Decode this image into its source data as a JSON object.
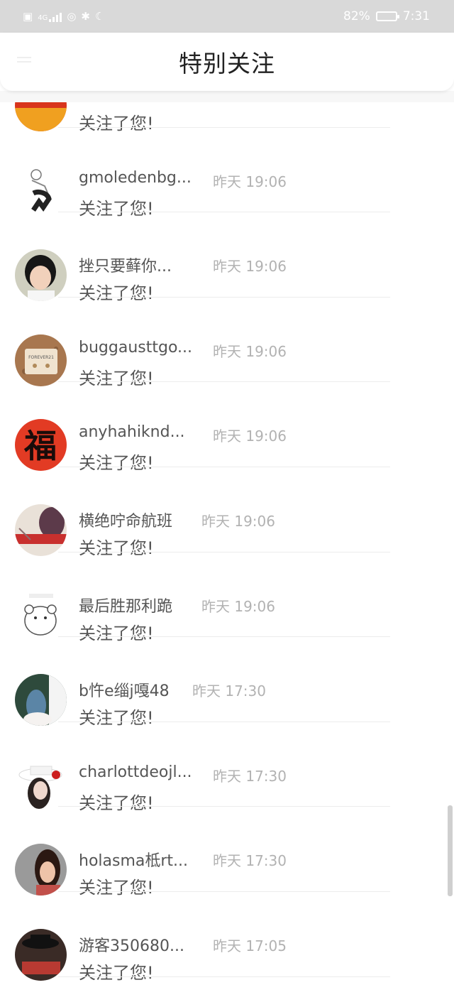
{
  "status_bar": {
    "left_icons": [
      "hd-icon",
      "4g-signal-icon",
      "wifi-hotspot-icon",
      "bluetooth-icon",
      "moon-icon"
    ],
    "network_label": "4G",
    "battery_percent": "82%",
    "battery_level": 0.82,
    "time": "7:31"
  },
  "header": {
    "title": "特别关注"
  },
  "list": [
    {
      "name": "",
      "time": "",
      "message": "关注了您!",
      "avatar": "red-gold-avatar"
    },
    {
      "name": "gmoledenbg...",
      "time": "昨天 19:06",
      "message": "关注了您!",
      "avatar": "sketch-figure-avatar"
    },
    {
      "name": "挫只要藓你...",
      "time": "昨天 19:06",
      "message": "关注了您!",
      "avatar": "girl-portrait-avatar"
    },
    {
      "name": "buggausttgo...",
      "time": "昨天 19:06",
      "message": "关注了您!",
      "avatar": "forever21-tag-avatar"
    },
    {
      "name": "anyhahiknd...",
      "time": "昨天 19:06",
      "message": "关注了您!",
      "avatar": "fu-character-avatar"
    },
    {
      "name": "横绝咛命航班",
      "time": "昨天 19:06",
      "message": "关注了您!",
      "avatar": "queen-text-avatar"
    },
    {
      "name": "最后胜那利跪",
      "time": "昨天 19:06",
      "message": "关注了您!",
      "avatar": "hamster-avatar"
    },
    {
      "name": "b忤e缁j嘎48",
      "time": "昨天 17:30",
      "message": "关注了您!",
      "avatar": "couple-photo-avatar"
    },
    {
      "name": "charlottdeojl...",
      "time": "昨天 17:30",
      "message": "关注了您!",
      "avatar": "hat-woman-avatar"
    },
    {
      "name": "holasma柢rt...",
      "time": "昨天 17:30",
      "message": "关注了您!",
      "avatar": "woman-portrait-avatar"
    },
    {
      "name": "游客350680...",
      "time": "昨天 17:05",
      "message": "关注了您!",
      "avatar": "hat-man-avatar"
    }
  ]
}
